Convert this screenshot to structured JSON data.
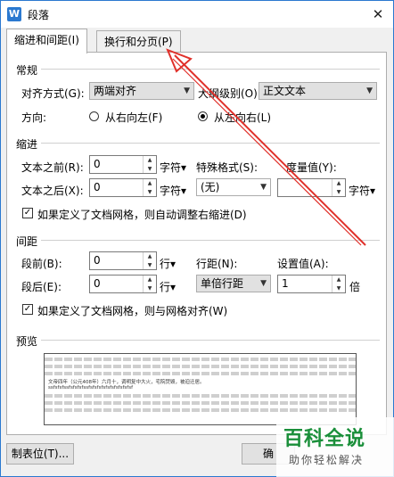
{
  "window": {
    "title": "段落",
    "app_icon_letter": "W",
    "close_glyph": "✕"
  },
  "tabs": [
    {
      "label": "缩进和间距(I)"
    },
    {
      "label": "换行和分页(P)"
    }
  ],
  "general": {
    "section_label": "常规",
    "align_label": "对齐方式(G):",
    "align_value": "两端对齐",
    "outline_label": "大纲级别(O):",
    "outline_value": "正文文本",
    "direction_label": "方向:",
    "rtl_label": "从右向左(F)",
    "ltr_label": "从左向右(L)"
  },
  "indent": {
    "section_label": "缩进",
    "before_label": "文本之前(R):",
    "before_value": "0",
    "before_unit": "字符▾",
    "after_label": "文本之后(X):",
    "after_value": "0",
    "after_unit": "字符▾",
    "special_label": "特殊格式(S):",
    "special_value": "(无)",
    "measure_label": "度量值(Y):",
    "measure_value": "",
    "measure_unit": "字符▾",
    "auto_adjust_label": "如果定义了文档网格，则自动调整右缩进(D)",
    "auto_adjust_mark": "✓"
  },
  "spacing": {
    "section_label": "间距",
    "before_label": "段前(B):",
    "before_value": "0",
    "before_unit": "行▾",
    "after_label": "段后(E):",
    "after_value": "0",
    "after_unit": "行▾",
    "line_label": "行距(N):",
    "line_value": "单倍行距",
    "setting_label": "设置值(A):",
    "setting_value": "1",
    "setting_unit": "倍",
    "grid_label": "如果定义了文档网格，则与网格对齐(W)",
    "grid_mark": "✓"
  },
  "preview": {
    "section_label": "预览",
    "sample_line1": "文帝四年（公元408年）六月十，调明复中大火，宅院焚毁，被迫迁居。",
    "sample_line2": "ssfsfsfssfsfsfsfssfsfsfsfsfsfsfsfsfsfsf"
  },
  "buttons": {
    "tabs_button": "制表位(T)...",
    "ok_button": "确"
  },
  "watermark": {
    "main": "百科全说",
    "sub": "助你轻松解决"
  }
}
